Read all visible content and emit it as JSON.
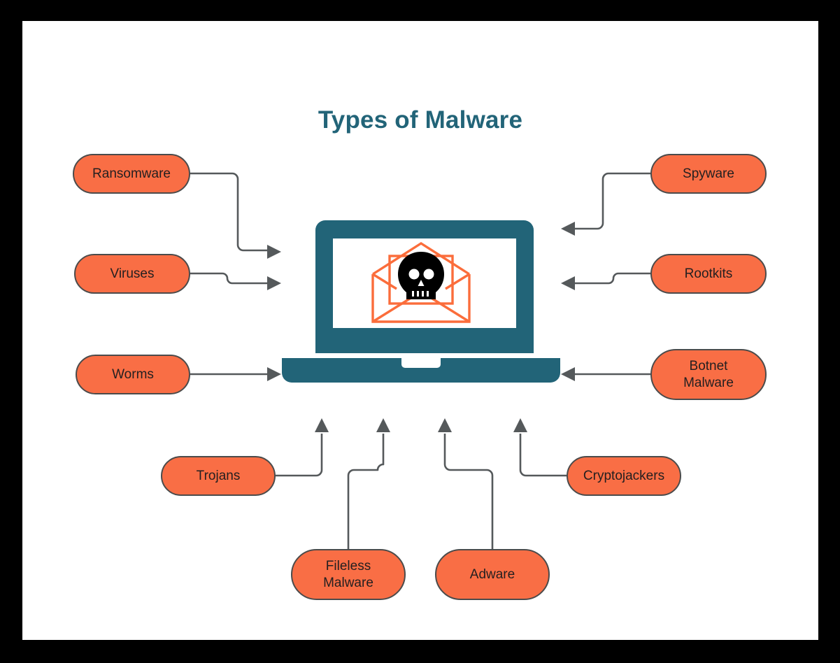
{
  "page": {
    "title": "Types of Malware",
    "background_color": "#000000",
    "card_color": "#ffffff",
    "accent_color": "#F96E45",
    "title_color": "#226478",
    "border_color": "#4B4B4B",
    "connector_color": "#55595B",
    "envelope_color": "#FB6D3B"
  },
  "center": {
    "device_name": "laptop-illustration",
    "screen_icon": "envelope-with-skull-icon"
  },
  "nodes": [
    {
      "id": "ransomware",
      "label": "Ransomware",
      "side": "left"
    },
    {
      "id": "viruses",
      "label": "Viruses",
      "side": "left"
    },
    {
      "id": "worms",
      "label": "Worms",
      "side": "left"
    },
    {
      "id": "spyware",
      "label": "Spyware",
      "side": "right"
    },
    {
      "id": "rootkits",
      "label": "Rootkits",
      "side": "right"
    },
    {
      "id": "botnet",
      "label": "Botnet\nMalware",
      "side": "right"
    },
    {
      "id": "trojans",
      "label": "Trojans",
      "side": "bottom"
    },
    {
      "id": "fileless",
      "label": "Fileless\nMalware",
      "side": "bottom"
    },
    {
      "id": "adware",
      "label": "Adware",
      "side": "bottom"
    },
    {
      "id": "cryptojackers",
      "label": "Cryptojackers",
      "side": "bottom"
    }
  ]
}
